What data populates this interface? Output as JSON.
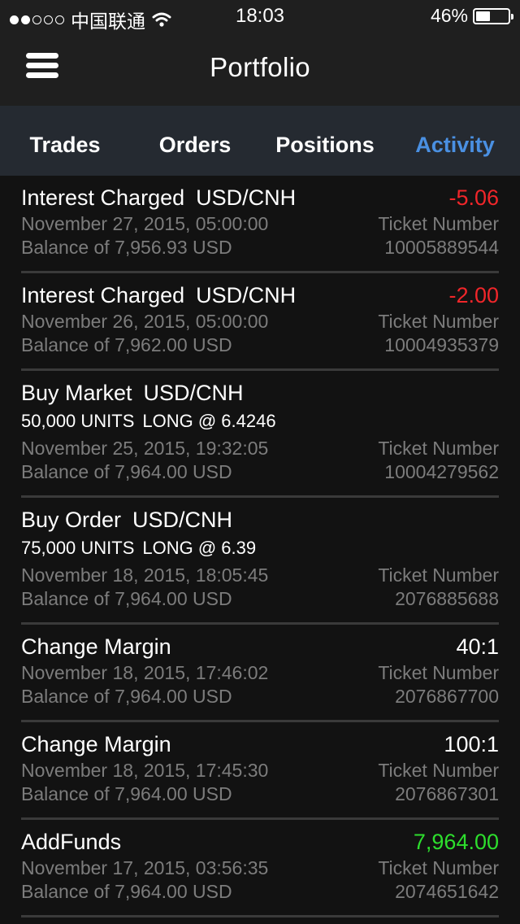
{
  "status_bar": {
    "signal_filled": 2,
    "signal_total": 5,
    "carrier": "中国联通",
    "time": "18:03",
    "battery_percent_label": "46%",
    "battery_level": 0.46
  },
  "nav": {
    "title": "Portfolio"
  },
  "tabs": [
    {
      "label": "Trades",
      "active": false
    },
    {
      "label": "Orders",
      "active": false
    },
    {
      "label": "Positions",
      "active": false
    },
    {
      "label": "Activity",
      "active": true
    }
  ],
  "colors": {
    "accent": "#4a90e2",
    "negative": "#f0262a",
    "positive": "#2dde2d",
    "muted": "#7c7c7c"
  },
  "activity": [
    {
      "title": "Interest Charged",
      "pair": "USD/CNH",
      "amount": "-5.06",
      "amount_type": "neg",
      "units": "",
      "direction": "",
      "date": "November 27, 2015, 05:00:00",
      "ticket_label": "Ticket Number",
      "balance": "Balance of 7,956.93 USD",
      "ticket_number": "10005889544"
    },
    {
      "title": "Interest Charged",
      "pair": "USD/CNH",
      "amount": "-2.00",
      "amount_type": "neg",
      "units": "",
      "direction": "",
      "date": "November 26, 2015, 05:00:00",
      "ticket_label": "Ticket Number",
      "balance": "Balance of 7,962.00 USD",
      "ticket_number": "10004935379"
    },
    {
      "title": "Buy Market",
      "pair": "USD/CNH",
      "amount": "",
      "amount_type": "neutral",
      "units": "50,000 UNITS",
      "direction": "LONG @ 6.4246",
      "date": "November 25, 2015, 19:32:05",
      "ticket_label": "Ticket Number",
      "balance": "Balance of 7,964.00 USD",
      "ticket_number": "10004279562"
    },
    {
      "title": "Buy Order",
      "pair": "USD/CNH",
      "amount": "",
      "amount_type": "neutral",
      "units": "75,000 UNITS",
      "direction": "LONG @ 6.39",
      "date": "November 18, 2015, 18:05:45",
      "ticket_label": "Ticket Number",
      "balance": "Balance of 7,964.00 USD",
      "ticket_number": "2076885688"
    },
    {
      "title": "Change Margin",
      "pair": "",
      "amount": "40:1",
      "amount_type": "neutral",
      "units": "",
      "direction": "",
      "date": "November 18, 2015, 17:46:02",
      "ticket_label": "Ticket Number",
      "balance": "Balance of 7,964.00 USD",
      "ticket_number": "2076867700"
    },
    {
      "title": "Change Margin",
      "pair": "",
      "amount": "100:1",
      "amount_type": "neutral",
      "units": "",
      "direction": "",
      "date": "November 18, 2015, 17:45:30",
      "ticket_label": "Ticket Number",
      "balance": "Balance of 7,964.00 USD",
      "ticket_number": "2076867301"
    },
    {
      "title": "AddFunds",
      "pair": "",
      "amount": "7,964.00",
      "amount_type": "pos",
      "units": "",
      "direction": "",
      "date": "November 17, 2015, 03:56:35",
      "ticket_label": "Ticket Number",
      "balance": "Balance of 7,964.00 USD",
      "ticket_number": "2074651642"
    }
  ]
}
